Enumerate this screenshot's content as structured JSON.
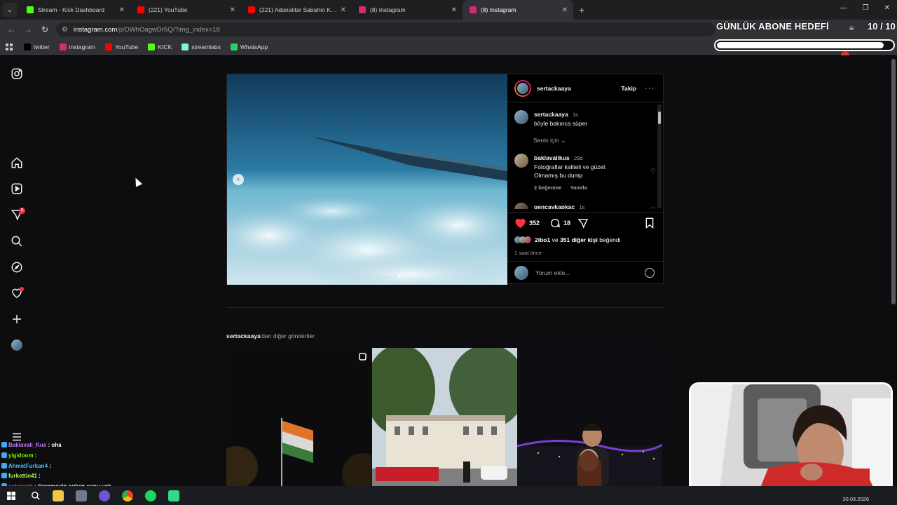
{
  "browser": {
    "tabs": [
      {
        "label": "Stream - Kick Dashboard",
        "icon": "kick-icon",
        "color": "#53fc18"
      },
      {
        "label": "(221) YouTube",
        "icon": "youtube-icon",
        "color": "#ff0000"
      },
      {
        "label": "(221) Adanalılar Sabahın Körün",
        "icon": "youtube-icon",
        "color": "#ff0000"
      },
      {
        "label": "(8) Instagram",
        "icon": "instagram-icon",
        "color": "#d62976"
      },
      {
        "label": "(8) Instagram",
        "icon": "instagram-icon",
        "color": "#d62976"
      }
    ],
    "active_tab_index": 4,
    "url_host": "instagram.com",
    "url_path": "/p/DWhOagwDr5Q/?img_index=18",
    "bookmarks": [
      {
        "label": "twitter",
        "icon": "x-icon",
        "color": "#000000"
      },
      {
        "label": "instagram",
        "icon": "instagram-icon",
        "color": "#d62976"
      },
      {
        "label": "YouTube",
        "icon": "youtube-icon",
        "color": "#ff0000"
      },
      {
        "label": "KICK",
        "icon": "kick-icon",
        "color": "#53fc18"
      },
      {
        "label": "streamlabs",
        "icon": "streamlabs-icon",
        "color": "#80f5d2"
      },
      {
        "label": "WhatsApp",
        "icon": "whatsapp-icon",
        "color": "#25d366"
      }
    ]
  },
  "overlay": {
    "goal_title": "GÜNLÜK ABONE HEDEFİ",
    "goal_count": "10 / 10",
    "goal_progress": 0.95
  },
  "post": {
    "username": "sertackaaya",
    "follow_label": "Takip",
    "caption": {
      "user": "sertackaaya",
      "time": "1s",
      "text": "böyle bakınca süper"
    },
    "for_you_label": "Senin için",
    "comments": [
      {
        "user": "baklavalikus",
        "time": "29d",
        "text_line1": "Fotoğraflar kaliteli ve güzel.",
        "text_line2": "Olmamış bu dump",
        "likes": "2 beğenme",
        "reply": "Yanıtla"
      },
      {
        "user": "gencaykapkac",
        "time": "1s"
      }
    ],
    "like_count": "352",
    "comment_count": "18",
    "liked_by_user": "2ibo1",
    "liked_by_middle": "ve",
    "liked_by_others": "351 diğer kişi",
    "liked_by_suffix": "beğendi",
    "time_ago": "1 saat önce",
    "add_comment_placeholder": "Yorum ekle...",
    "slide_count": 18,
    "active_slide": 18
  },
  "more_posts": {
    "user": "sertackaaya",
    "suffix": "'dan diğer gönderiler"
  },
  "chat": [
    {
      "user": "Baklavali_Kus",
      "color": "#c77dff",
      "text": "oha"
    },
    {
      "user": "yigidoom",
      "color": "#7cfc00",
      "text": ""
    },
    {
      "user": "AhmetFurkan4",
      "color": "#4fc3f7",
      "text": ""
    },
    {
      "user": "furkettin41",
      "color": "#b2ff59",
      "text": ""
    },
    {
      "user": "asteraski",
      "color": "#ff5252",
      "text": "özenmeyin oglum sonu yok"
    }
  ],
  "taskbar": {
    "date": "30.03.2026"
  }
}
